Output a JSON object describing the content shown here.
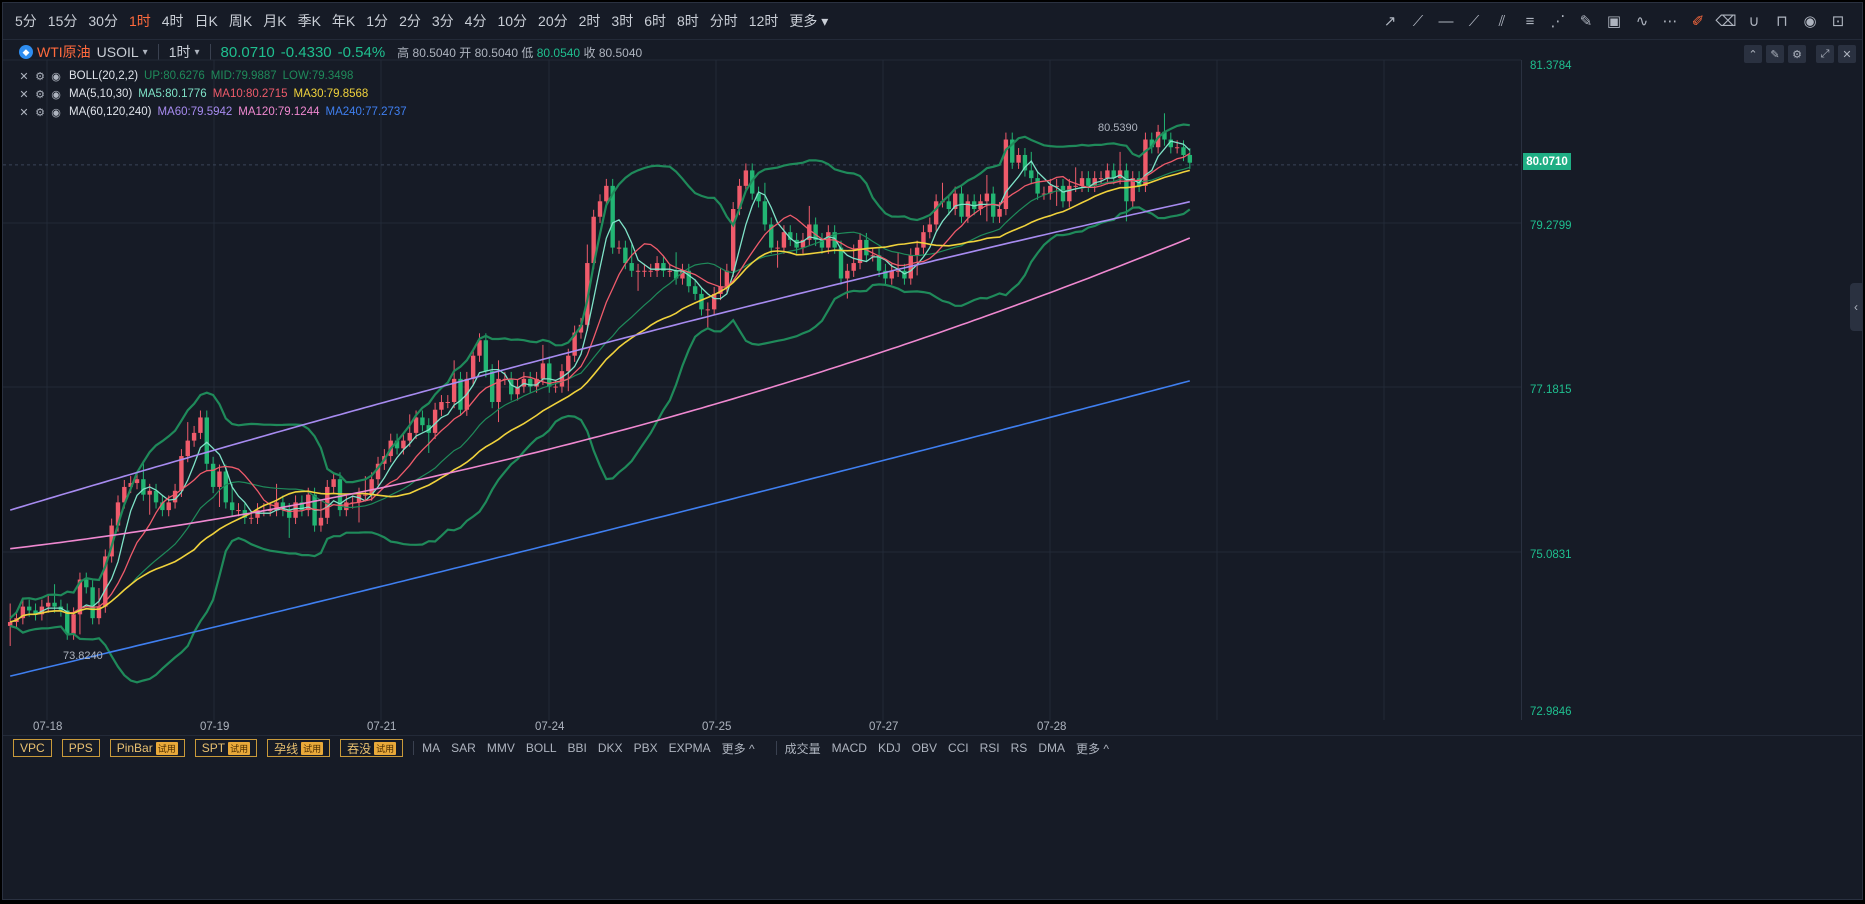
{
  "periods": [
    "5分",
    "15分",
    "30分",
    "1时",
    "4时",
    "日K",
    "周K",
    "月K",
    "季K",
    "年K",
    "1分",
    "2分",
    "3分",
    "4分",
    "10分",
    "20分",
    "2时",
    "3时",
    "6时",
    "8时",
    "分时",
    "12时",
    "更多"
  ],
  "active_period": "1时",
  "symbol": {
    "name": "WTI原油",
    "code": "USOIL",
    "interval": "1时",
    "price": "80.0710",
    "change": "-0.4330",
    "change_pct": "-0.54%",
    "high_label": "高",
    "high": "80.5040",
    "open_label": "开",
    "open": "80.5040",
    "low_label": "低",
    "low": "80.0540",
    "close_label": "收",
    "close": "80.5040"
  },
  "legends": {
    "boll": {
      "name": "BOLL(20,2,2)",
      "up": "UP:80.6276",
      "mid": "MID:79.9887",
      "low": "LOW:79.3498"
    },
    "ma1": {
      "name": "MA(5,10,30)",
      "a": "MA5:80.1776",
      "b": "MA10:80.2715",
      "c": "MA30:79.8568"
    },
    "ma2": {
      "name": "MA(60,120,240)",
      "a": "MA60:79.5942",
      "b": "MA120:79.1244",
      "c": "MA240:77.2737"
    }
  },
  "y_axis": [
    "81.3784",
    "79.2799",
    "77.1815",
    "75.0831",
    "72.9846"
  ],
  "current_price_tag": "80.0710",
  "x_axis": [
    "07-18",
    "07-19",
    "07-21",
    "07-24",
    "07-25",
    "07-27",
    "07-28"
  ],
  "annotations": {
    "max": "80.5390",
    "min": "73.8240"
  },
  "bottom": {
    "tools": [
      {
        "label": "VPC",
        "trial": ""
      },
      {
        "label": "PPS",
        "trial": ""
      },
      {
        "label": "PinBar",
        "trial": "试用"
      },
      {
        "label": "SPT",
        "trial": "试用"
      },
      {
        "label": "孕线",
        "trial": "试用"
      },
      {
        "label": "吞没",
        "trial": "试用"
      }
    ],
    "main_indicators": [
      "MA",
      "SAR",
      "MMV",
      "BOLL",
      "BBI",
      "DKX",
      "PBX",
      "EXPMA",
      "更多 ^"
    ],
    "sub_indicators": [
      "成交量",
      "MACD",
      "KDJ",
      "OBV",
      "CCI",
      "RSI",
      "RS",
      "DMA",
      "更多 ^"
    ]
  },
  "colors": {
    "up": "#ef5b6b",
    "down": "#22b573",
    "boll": "#1f8a5a",
    "ma5": "#7fe3c8",
    "ma10": "#ef5b6b",
    "ma30": "#f0d23c",
    "ma60": "#a78bf0",
    "ma120": "#ef88d0",
    "ma240": "#3f7ff0"
  },
  "chart_data": {
    "type": "candlestick",
    "ylim": [
      72.9846,
      81.3784
    ],
    "x_ticks": [
      "07-18",
      "07-19",
      "07-21",
      "07-24",
      "07-25",
      "07-27",
      "07-28"
    ],
    "close": [
      74.15,
      74.2,
      74.35,
      74.3,
      74.25,
      74.35,
      74.4,
      74.35,
      74.3,
      74.0,
      74.25,
      74.7,
      74.6,
      74.2,
      74.35,
      75.0,
      75.4,
      75.7,
      75.9,
      75.95,
      76.0,
      75.8,
      75.85,
      75.7,
      75.6,
      75.7,
      75.85,
      76.3,
      76.5,
      76.6,
      76.8,
      76.2,
      75.9,
      76.1,
      75.7,
      75.6,
      75.6,
      75.5,
      75.5,
      75.6,
      75.6,
      75.6,
      75.7,
      75.6,
      75.5,
      75.7,
      75.6,
      75.8,
      75.4,
      75.5,
      75.9,
      76.0,
      75.6,
      75.7,
      75.7,
      75.8,
      75.8,
      76.0,
      76.2,
      76.3,
      76.5,
      76.4,
      76.5,
      76.6,
      76.8,
      76.7,
      76.6,
      76.9,
      77.0,
      77.0,
      77.3,
      76.9,
      77.3,
      77.6,
      77.8,
      77.4,
      77.0,
      77.3,
      77.3,
      77.1,
      77.2,
      77.3,
      77.2,
      77.3,
      77.5,
      77.2,
      77.2,
      77.4,
      77.6,
      77.9,
      78.0,
      78.8,
      79.4,
      79.6,
      79.8,
      79.0,
      79.0,
      78.8,
      78.7,
      78.7,
      78.7,
      78.7,
      78.8,
      78.7,
      78.7,
      78.6,
      78.7,
      78.5,
      78.4,
      78.2,
      78.2,
      78.4,
      78.5,
      78.7,
      79.5,
      79.8,
      80.0,
      79.7,
      79.6,
      79.3,
      79.0,
      79.0,
      79.2,
      79.1,
      79.0,
      79.1,
      79.3,
      79.1,
      79.0,
      79.2,
      79.0,
      78.6,
      78.7,
      78.8,
      79.1,
      78.9,
      78.9,
      78.7,
      78.6,
      78.7,
      78.7,
      78.6,
      78.9,
      79.0,
      79.2,
      79.3,
      79.6,
      79.6,
      79.5,
      79.7,
      79.4,
      79.6,
      79.5,
      79.6,
      79.7,
      79.4,
      79.5,
      80.4,
      80.1,
      80.2,
      80.0,
      79.9,
      79.7,
      79.7,
      79.8,
      79.8,
      79.6,
      79.8,
      79.8,
      79.9,
      79.8,
      79.9,
      79.9,
      80.0,
      79.9,
      80.0,
      79.6,
      79.9,
      79.8,
      80.4,
      80.3,
      80.5,
      80.4,
      80.3,
      80.3,
      80.2,
      80.1
    ],
    "boll_up_end": 80.6276,
    "boll_mid_end": 79.9887,
    "boll_low_end": 79.3498,
    "ma5_end": 80.1776,
    "ma10_end": 80.2715,
    "ma30_end": 79.8568,
    "ma60_end": 79.5942,
    "ma120_end": 79.1244,
    "ma240_end": 77.2737
  }
}
